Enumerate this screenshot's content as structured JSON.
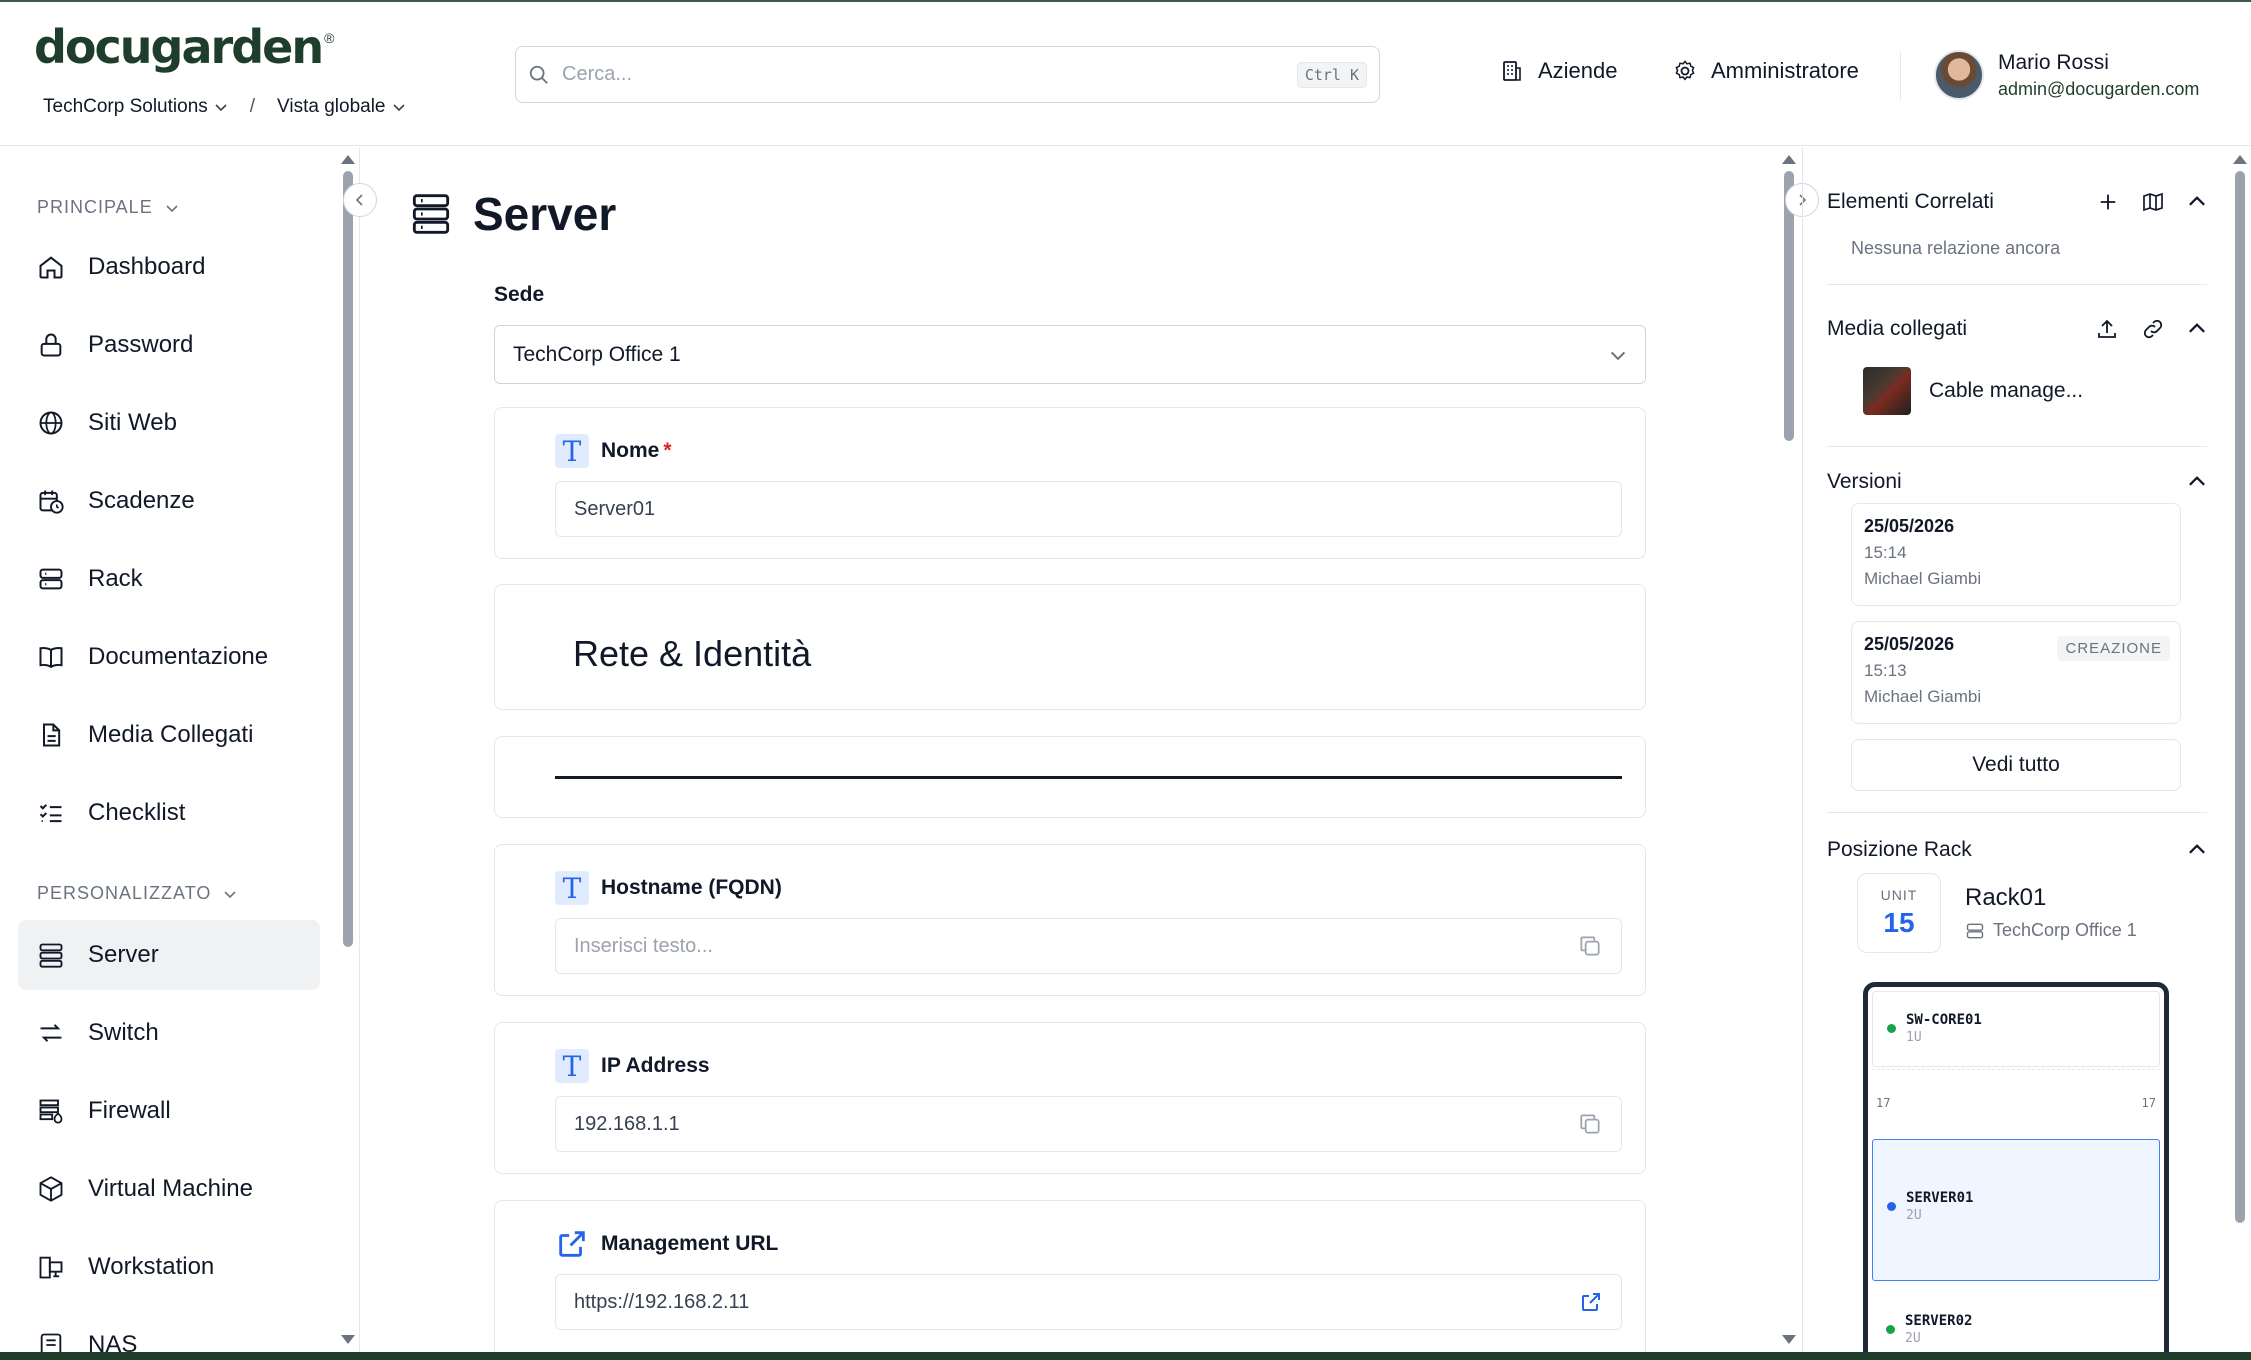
{
  "brand": {
    "logo_text": "docugarden",
    "logo_mark": "®"
  },
  "breadcrumb": {
    "company": "TechCorp Solutions",
    "separator": "/",
    "view": "Vista globale"
  },
  "search": {
    "placeholder": "Cerca...",
    "shortcut": "Ctrl K"
  },
  "header_nav": {
    "companies": "Aziende",
    "admin": "Amministratore"
  },
  "user": {
    "name": "Mario Rossi",
    "email": "admin@docugarden.com"
  },
  "sidebar": {
    "section_main": "PRINCIPALE",
    "main_items": [
      {
        "label": "Dashboard",
        "icon": "home-icon"
      },
      {
        "label": "Password",
        "icon": "lock-icon"
      },
      {
        "label": "Siti Web",
        "icon": "globe-icon"
      },
      {
        "label": "Scadenze",
        "icon": "calendar-clock-icon"
      },
      {
        "label": "Rack",
        "icon": "server-icon"
      },
      {
        "label": "Documentazione",
        "icon": "book-icon"
      },
      {
        "label": "Media Collegati",
        "icon": "file-icon"
      },
      {
        "label": "Checklist",
        "icon": "checklist-icon"
      }
    ],
    "section_custom": "PERSONALIZZATO",
    "custom_items": [
      {
        "label": "Server",
        "icon": "server-stack-icon",
        "active": true
      },
      {
        "label": "Switch",
        "icon": "switch-arrows-icon"
      },
      {
        "label": "Firewall",
        "icon": "firewall-icon"
      },
      {
        "label": "Virtual Machine",
        "icon": "cube-icon"
      },
      {
        "label": "Workstation",
        "icon": "monitor-icon"
      },
      {
        "label": "NAS",
        "icon": "nas-icon"
      }
    ]
  },
  "main": {
    "title": "Server",
    "sede_label": "Sede",
    "sede_value": "TechCorp Office 1",
    "nome_label": "Nome",
    "nome_required": "*",
    "nome_value": "Server01",
    "section_heading": "Rete & Identità",
    "hostname_label": "Hostname (FQDN)",
    "hostname_placeholder": "Inserisci testo...",
    "ip_label": "IP Address",
    "ip_value": "192.168.1.1",
    "mgmt_label": "Management URL",
    "mgmt_value": "https://192.168.2.11"
  },
  "right_panel": {
    "related_title": "Elementi Correlati",
    "related_empty": "Nessuna relazione ancora",
    "media_title": "Media collegati",
    "media_item": "Cable manage...",
    "versions_title": "Versioni",
    "versions": [
      {
        "date": "25/05/2026",
        "time": "15:14",
        "author": "Michael Giambi",
        "badge": ""
      },
      {
        "date": "25/05/2026",
        "time": "15:13",
        "author": "Michael Giambi",
        "badge": "CREAZIONE"
      }
    ],
    "see_all": "Vedi tutto",
    "rack_title": "Posizione Rack",
    "unit_label": "UNIT",
    "unit_value": "15",
    "rack_name": "Rack01",
    "rack_location": "TechCorp Office 1",
    "rack_slots": [
      {
        "name": "SW-CORE01",
        "size": "1U",
        "color": "#16a34a"
      },
      {
        "name": "SERVER01",
        "size": "2U",
        "color": "#2563eb"
      },
      {
        "name": "SERVER02",
        "size": "2U",
        "color": "#16a34a"
      }
    ],
    "rack_empty_unit": "17"
  },
  "colors": {
    "brand": "#1f3d2b",
    "accent": "#2563eb",
    "required": "#dc2626"
  }
}
